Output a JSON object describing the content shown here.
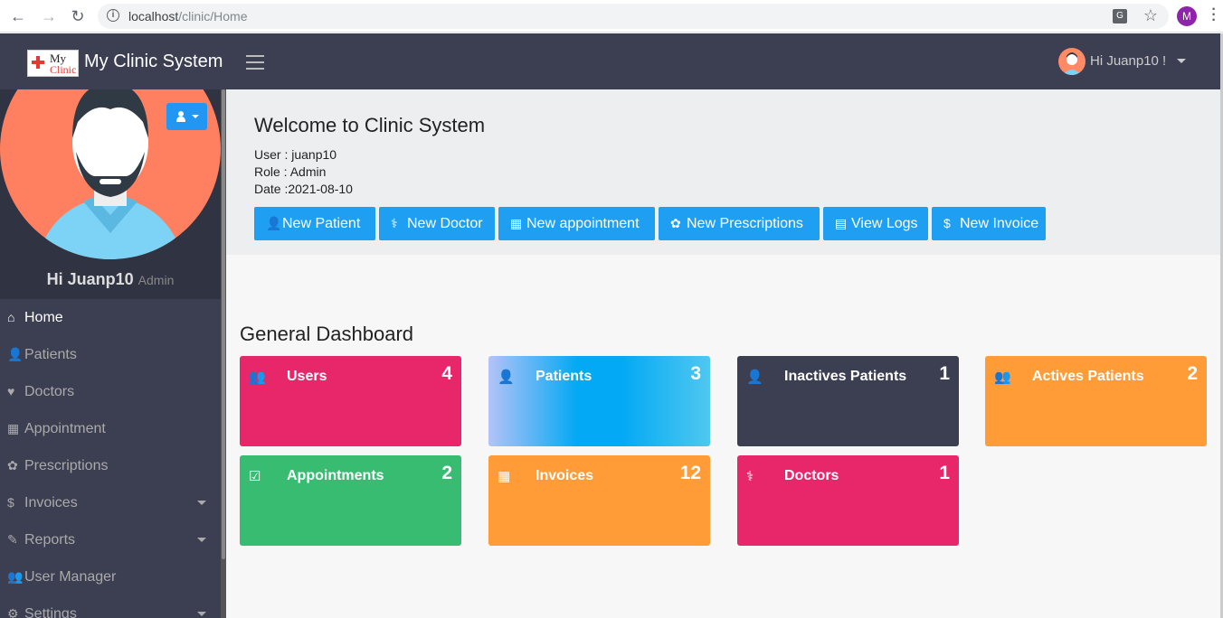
{
  "browser": {
    "url_host": "localhost",
    "url_path": "/clinic/Home",
    "profile_initial": "M"
  },
  "topbar": {
    "app_title": "My Clinic System",
    "logo_line1": "My",
    "logo_line2": "Clinic",
    "greeting": "Hi Juanp10 !"
  },
  "sidebar": {
    "user_name": "Hi Juanp10",
    "user_role": "Admin",
    "items": [
      {
        "label": "Home",
        "icon": "home-icon",
        "glyph": "⌂",
        "active": true,
        "has_dropdown": false
      },
      {
        "label": "Patients",
        "icon": "user-plus-icon",
        "glyph": "👤",
        "active": false,
        "has_dropdown": false
      },
      {
        "label": "Doctors",
        "icon": "heartbeat-icon",
        "glyph": "♥",
        "active": false,
        "has_dropdown": false
      },
      {
        "label": "Appointment",
        "icon": "calendar-icon",
        "glyph": "▦",
        "active": false,
        "has_dropdown": false
      },
      {
        "label": "Prescriptions",
        "icon": "pills-icon",
        "glyph": "✿",
        "active": false,
        "has_dropdown": false
      },
      {
        "label": "Invoices",
        "icon": "dollar-icon",
        "glyph": "$",
        "active": false,
        "has_dropdown": true
      },
      {
        "label": "Reports",
        "icon": "edit-icon",
        "glyph": "✎",
        "active": false,
        "has_dropdown": true
      },
      {
        "label": "User Manager",
        "icon": "users-icon",
        "glyph": "👥",
        "active": false,
        "has_dropdown": false
      },
      {
        "label": "Settings",
        "icon": "gear-icon",
        "glyph": "⚙",
        "active": false,
        "has_dropdown": true
      }
    ]
  },
  "welcome": {
    "title": "Welcome to Clinic System",
    "user_line": "User : juanp10",
    "role_line": "Role : Admin",
    "date_line": "Date :2021-08-10"
  },
  "actions": [
    {
      "label": "New Patient",
      "icon": "user-plus-icon",
      "glyph": "👤"
    },
    {
      "label": "New Doctor",
      "icon": "user-md-icon",
      "glyph": "⚕"
    },
    {
      "label": "New appointment",
      "icon": "calendar-icon",
      "glyph": "▦"
    },
    {
      "label": "New Prescriptions",
      "icon": "pills-icon",
      "glyph": "✿"
    },
    {
      "label": "View Logs",
      "icon": "file-text-icon",
      "glyph": "▤"
    },
    {
      "label": "New Invoice",
      "icon": "dollar-icon",
      "glyph": "$"
    }
  ],
  "dashboard": {
    "title": "General Dashboard",
    "cards": [
      {
        "label": "Users",
        "value": "4",
        "icon": "users-icon",
        "glyph": "👥",
        "color": "#e8266a"
      },
      {
        "label": "Patients",
        "value": "3",
        "icon": "user-plus-icon",
        "glyph": "👤",
        "color": "gradient-blue"
      },
      {
        "label": "Inactives Patients",
        "value": "1",
        "icon": "user-times-icon",
        "glyph": "👤",
        "color": "#3b3f51"
      },
      {
        "label": "Actives Patients",
        "value": "2",
        "icon": "users-icon",
        "glyph": "👥",
        "color": "#ff9c37"
      },
      {
        "label": "Appointments",
        "value": "2",
        "icon": "calendar-check-icon",
        "glyph": "☑",
        "color": "#37bc72"
      },
      {
        "label": "Invoices",
        "value": "12",
        "icon": "calculator-icon",
        "glyph": "▦",
        "color": "#ff9c37"
      },
      {
        "label": "Doctors",
        "value": "1",
        "icon": "user-md-icon",
        "glyph": "⚕",
        "color": "#e8266a"
      }
    ]
  }
}
